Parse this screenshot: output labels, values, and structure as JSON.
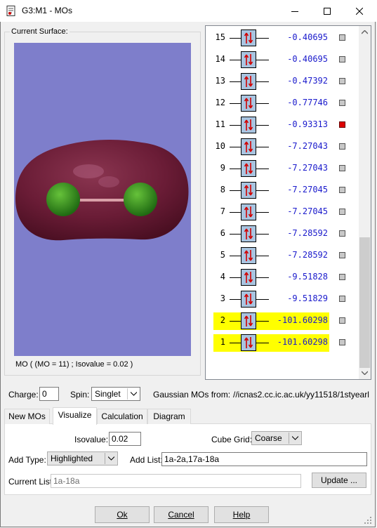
{
  "window": {
    "title": "G3:M1 - MOs"
  },
  "surface": {
    "group_label": "Current Surface:",
    "caption": "MO ( (MO = 11) ; Isovalue = 0.02 )"
  },
  "mo_list": [
    {
      "num": "15",
      "energy": "-0.40695",
      "highlighted": false,
      "selected": false
    },
    {
      "num": "14",
      "energy": "-0.40695",
      "highlighted": false,
      "selected": false
    },
    {
      "num": "13",
      "energy": "-0.47392",
      "highlighted": false,
      "selected": false
    },
    {
      "num": "12",
      "energy": "-0.77746",
      "highlighted": false,
      "selected": false
    },
    {
      "num": "11",
      "energy": "-0.93313",
      "highlighted": false,
      "selected": true
    },
    {
      "num": "10",
      "energy": "-7.27043",
      "highlighted": false,
      "selected": false
    },
    {
      "num": "9",
      "energy": "-7.27043",
      "highlighted": false,
      "selected": false
    },
    {
      "num": "8",
      "energy": "-7.27045",
      "highlighted": false,
      "selected": false
    },
    {
      "num": "7",
      "energy": "-7.27045",
      "highlighted": false,
      "selected": false
    },
    {
      "num": "6",
      "energy": "-7.28592",
      "highlighted": false,
      "selected": false
    },
    {
      "num": "5",
      "energy": "-7.28592",
      "highlighted": false,
      "selected": false
    },
    {
      "num": "4",
      "energy": "-9.51828",
      "highlighted": false,
      "selected": false
    },
    {
      "num": "3",
      "energy": "-9.51829",
      "highlighted": false,
      "selected": false
    },
    {
      "num": "2",
      "energy": "-101.60298",
      "highlighted": true,
      "selected": false
    },
    {
      "num": "1",
      "energy": "-101.60298",
      "highlighted": true,
      "selected": false
    }
  ],
  "controls": {
    "charge_label": "Charge:",
    "charge_value": "0",
    "spin_label": "Spin:",
    "spin_value": "Singlet",
    "source_label": "Gaussian MOs from:",
    "source_path": "//icnas2.cc.ic.ac.uk/yy11518/1styearl"
  },
  "tabs": [
    "New MOs",
    "Visualize",
    "Calculation",
    "Diagram"
  ],
  "active_tab": "Visualize",
  "visualize": {
    "isovalue_label": "Isovalue:",
    "isovalue": "0.02",
    "cube_grid_label": "Cube Grid:",
    "cube_grid": "Coarse",
    "add_type_label": "Add Type:",
    "add_type": "Highlighted",
    "add_list_label": "Add List:",
    "add_list": "1a-2a,17a-18a",
    "current_list_label": "Current List:",
    "current_list": "1a-18a",
    "update_button": "Update ..."
  },
  "footer": {
    "ok": "Ok",
    "cancel": "Cancel",
    "help": "Help"
  },
  "colors": {
    "highlight": "#ffff00",
    "selected": "#dd0000",
    "energy_text": "#1a1acc",
    "surface": "#6e1e38",
    "background": "#7e7ecb"
  }
}
